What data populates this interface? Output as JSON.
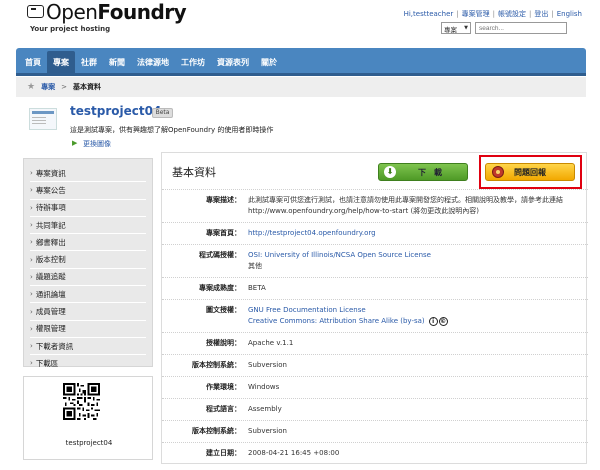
{
  "header": {
    "logo_open": "Open",
    "logo_foundry": "Foundry",
    "tagline": "Your project hosting",
    "toplinks": [
      "Hi,testteacher",
      "專案管理",
      "帳號設定",
      "登出",
      "English"
    ],
    "search": {
      "scope": "專案",
      "placeholder": "search..."
    }
  },
  "nav": {
    "items": [
      {
        "label": "首頁",
        "active": false
      },
      {
        "label": "專案",
        "active": true
      },
      {
        "label": "社群",
        "active": false
      },
      {
        "label": "新聞",
        "active": false
      },
      {
        "label": "法律源地",
        "active": false
      },
      {
        "label": "工作坊",
        "active": false
      },
      {
        "label": "資源表列",
        "active": false
      },
      {
        "label": "關於",
        "active": false
      }
    ]
  },
  "breadcrumb": {
    "link": "專案",
    "separator": ">",
    "current": "基本資料"
  },
  "project": {
    "name": "testproject04",
    "badge": "Beta",
    "description": "這是測試專案，供有興趣想了解OpenFoundry 的使用者即時操作",
    "change_image": "更換圖像"
  },
  "sidebar": {
    "items": [
      "專案資訊",
      "專案公告",
      "待辦事項",
      "共同筆記",
      "鄉書釋出",
      "版本控制",
      "議題追蹤",
      "通訊論壇",
      "成員管理",
      "權限管理",
      "下載者資訊",
      "下載區"
    ],
    "qr_label": "testproject04"
  },
  "main": {
    "title": "基本資料",
    "download_label": "下載",
    "report_label": "問題回報",
    "rows": [
      {
        "key": "專案描述：",
        "values": [
          "此測試專案可供您進行測試，也請注意請勿使用此專案開發您的程式。相關說明及教學，請參考此連結 http://www.openfoundry.org/help/how-to-start (將勿更改此說明內容)"
        ],
        "links": false
      },
      {
        "key": "專案首頁：",
        "values": [
          "http://testproject04.openfoundry.org"
        ],
        "links": true
      },
      {
        "key": "程式碼授權：",
        "values": [
          "OSI: University of Illinois/NCSA Open Source License",
          "其他"
        ],
        "links": "first"
      },
      {
        "key": "專案成熟度：",
        "values": [
          "BETA"
        ],
        "links": false
      },
      {
        "key": "圖文授權：",
        "values": [
          "GNU Free Documentation License",
          "Creative Commons: Attribution Share Alike (by-sa)"
        ],
        "links": true,
        "cc": true
      },
      {
        "key": "授權說明：",
        "values": [
          "Apache v.1.1"
        ],
        "links": false
      },
      {
        "key": "版本控制系統：",
        "values": [
          "Subversion"
        ],
        "links": false
      },
      {
        "key": "作業環境：",
        "values": [
          "Windows"
        ],
        "links": false
      },
      {
        "key": "程式語言：",
        "values": [
          "Assembly"
        ],
        "links": false
      },
      {
        "key": "版本控制系統：",
        "values": [
          "Subversion"
        ],
        "links": false
      },
      {
        "key": "建立日期：",
        "values": [
          "2008-04-21 16:45 +08:00"
        ],
        "links": false
      }
    ]
  }
}
